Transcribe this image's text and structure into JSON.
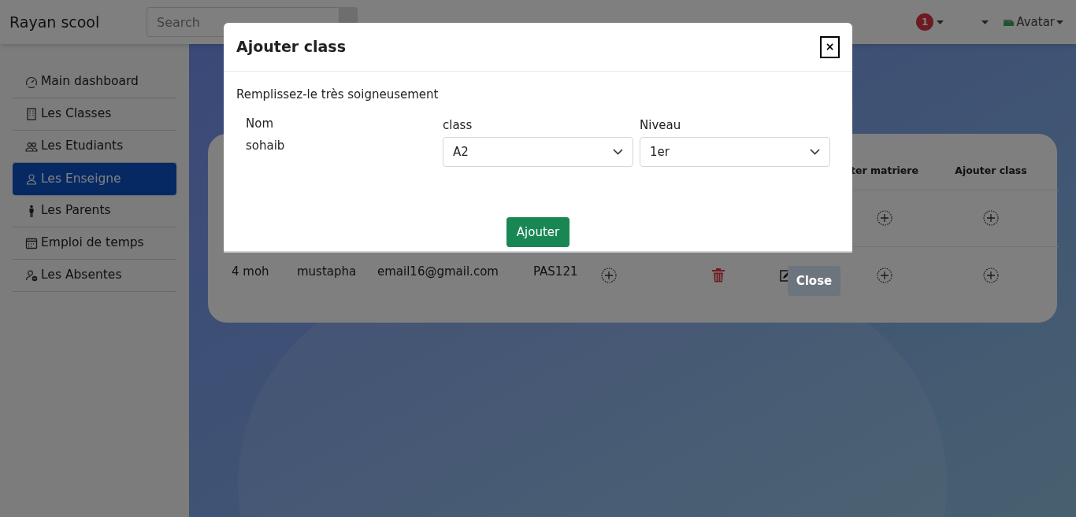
{
  "navbar": {
    "brand": "Rayan scool",
    "search": {
      "placeholder": "Search"
    },
    "notification_count": "1",
    "avatar_alt": "Avatar"
  },
  "sidebar": {
    "items": [
      {
        "label": "Main dashboard",
        "kind": "gauge",
        "selected": false
      },
      {
        "label": "Les Classes",
        "kind": "building",
        "selected": false
      },
      {
        "label": "Les Etudiants",
        "kind": "people",
        "selected": false
      },
      {
        "label": "Les Enseigne",
        "kind": "person",
        "selected": true
      },
      {
        "label": "Les Parents",
        "kind": "standing",
        "selected": false
      },
      {
        "label": "Emploi de temps",
        "kind": "calendar",
        "selected": false
      },
      {
        "label": "Les Absentes",
        "kind": "absent",
        "selected": false
      }
    ]
  },
  "table": {
    "columns": [
      "ter matriere",
      "Ajouter class"
    ],
    "rows": [
      {
        "cells": [
          {
            "kind": "add"
          },
          {
            "kind": "add"
          }
        ]
      },
      {
        "cells": [
          {
            "kind": "text",
            "text": "4 moh"
          },
          {
            "kind": "text",
            "text": "mustapha"
          },
          {
            "kind": "text",
            "text": "email16@gmail.com"
          },
          {
            "kind": "text",
            "text": "PAS121"
          },
          {
            "kind": "add"
          },
          {
            "kind": "delete"
          },
          {
            "kind": "edit"
          },
          {
            "kind": "add"
          },
          {
            "kind": "add"
          }
        ]
      }
    ]
  },
  "modal": {
    "title": "Ajouter class",
    "close_label": "×",
    "instruction": "Remplissez-le très soigneusement",
    "fields": [
      {
        "kind": "text",
        "label": "Nom",
        "value": "sohaib"
      },
      {
        "kind": "select",
        "label": "class",
        "value": "A2"
      },
      {
        "kind": "select",
        "label": "Niveau",
        "value": "1er"
      }
    ],
    "submit": "Ajouter"
  },
  "close_button": "Close"
}
